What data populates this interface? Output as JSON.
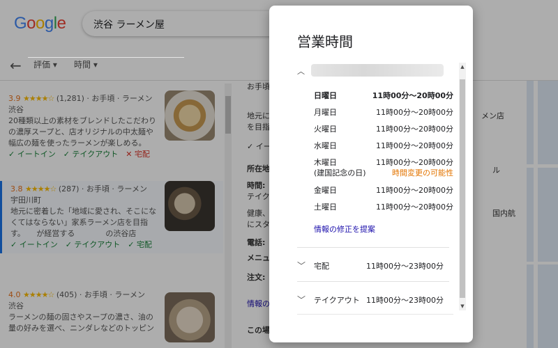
{
  "search": {
    "query": "渋谷 ラーメン屋"
  },
  "filters": [
    {
      "label": "評価 ▾"
    },
    {
      "label": "時間 ▾"
    }
  ],
  "results": [
    {
      "rating": "3.9",
      "stars": "★★★★☆",
      "reviews": "(1,281)",
      "price": "お手頃",
      "category": "ラーメン",
      "location": "渋谷",
      "desc1": "20種類以上の素材をブレンドしたこだわり",
      "desc2": "の濃厚スープと、店オリジナルの中太麺や",
      "desc3": "幅広の麺を使ったラーメンが楽しめる。",
      "opt_dinein": "✓ イートイン",
      "opt_takeout": "✓ テイクアウト",
      "opt_delivery": "✕ 宅配"
    },
    {
      "rating": "3.8",
      "stars": "★★★★☆",
      "reviews": "(287)",
      "price": "お手頃",
      "category": "ラーメン",
      "location": "宇田川町",
      "desc1": "地元に密着した「地域に愛され、そこにな",
      "desc2": "くてはならない」家系ラーメン店を目指",
      "desc3": "す。　　が経営する　　　　の渋谷店",
      "opt_dinein": "✓ イートイン",
      "opt_takeout": "✓ テイクアウト",
      "opt_delivery": "✓ 宅配"
    },
    {
      "rating": "4.0",
      "stars": "★★★★☆",
      "reviews": "(405)",
      "price": "お手頃",
      "category": "ラーメン",
      "location": "渋谷",
      "desc1": "ラーメンの麺の固さやスープの濃さ、油の",
      "desc2": "量の好みを選べ、ニンダレなどのトッピン"
    }
  ],
  "detail": {
    "line1": "お手頃",
    "line2": "地元に",
    "line3": "を目指",
    "line4": "✓ イー",
    "line5": "所在地",
    "line6": "時間:",
    "line7": "テイク",
    "line8": "健康、",
    "line9": "にスタ",
    "line10": "電話:",
    "line11": "メニュ",
    "line12": "注文:",
    "line13": "情報の",
    "line14": "この場",
    "map1": "メン店",
    "map2": "ル",
    "map3": "国内航"
  },
  "dialog": {
    "title": "営業時間",
    "hours": [
      {
        "day": "日曜日",
        "time": "11時00分～20時00分"
      },
      {
        "day": "月曜日",
        "time": "11時00分～20時00分"
      },
      {
        "day": "火曜日",
        "time": "11時00分～20時00分"
      },
      {
        "day": "水曜日",
        "time": "11時00分～20時00分"
      },
      {
        "day": "木曜日",
        "time": "11時00分～20時00分",
        "note": "(建国記念の日)",
        "warning": "時間変更の可能性"
      },
      {
        "day": "金曜日",
        "time": "11時00分～20時00分"
      },
      {
        "day": "土曜日",
        "time": "11時00分～20時00分"
      }
    ],
    "suggest_edit": "情報の修正を提案",
    "services": [
      {
        "label": "宅配",
        "time": "11時00分～23時00分"
      },
      {
        "label": "テイクアウト",
        "time": "11時00分～23時00分"
      }
    ]
  },
  "colors": {
    "warning": "#e37400",
    "link": "#1a0dab",
    "overlay": "rgba(0,0,0,0.32)"
  }
}
